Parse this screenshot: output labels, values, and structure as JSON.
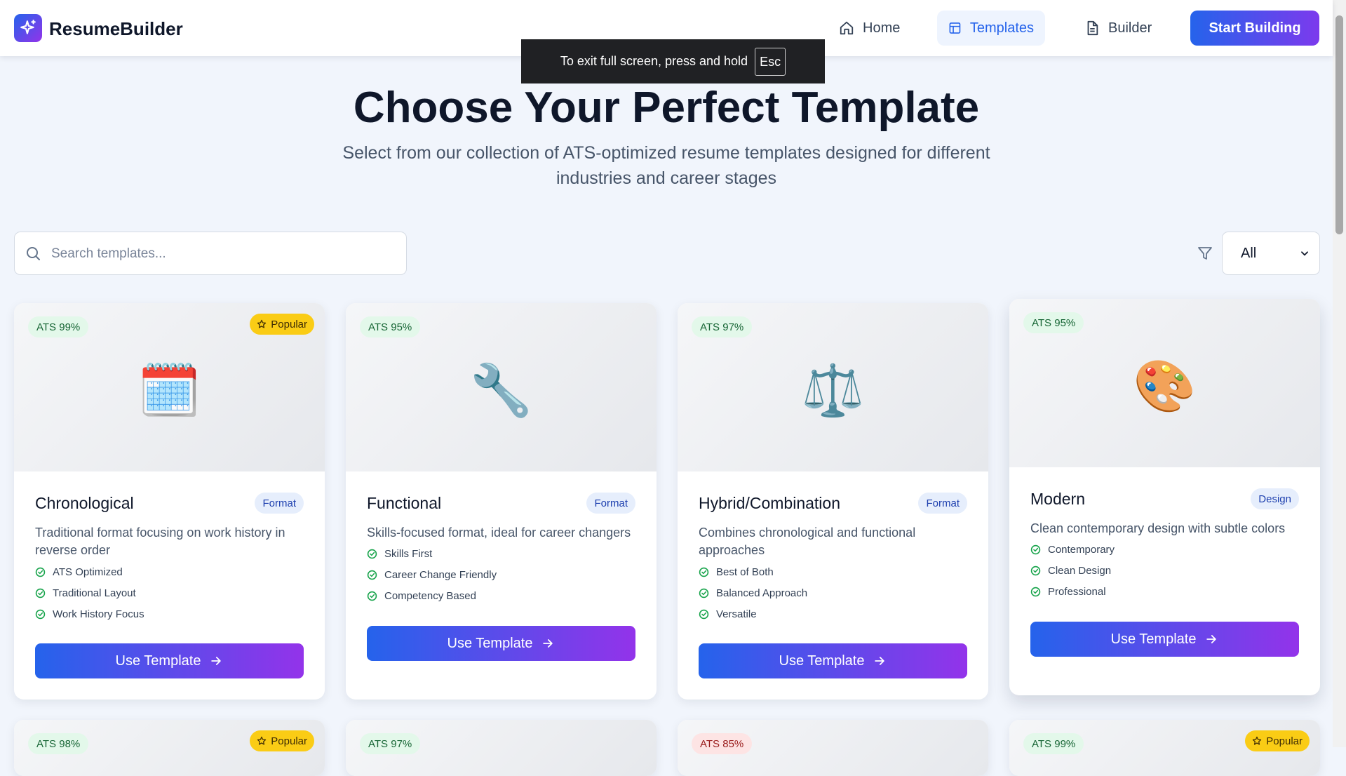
{
  "nav": {
    "brand": "ResumeBuilder",
    "links": [
      {
        "label": "Home",
        "icon": "home-icon"
      },
      {
        "label": "Templates",
        "icon": "layout-icon",
        "active": true
      },
      {
        "label": "Builder",
        "icon": "file-text-icon"
      }
    ],
    "cta": "Start Building"
  },
  "fullscreen_notice": {
    "text": "To exit full screen, press and hold",
    "key": "Esc"
  },
  "hero": {
    "title": "Choose Your Perfect Template",
    "subtitle": "Select from our collection of ATS-optimized resume templates designed for different industries and career stages"
  },
  "search": {
    "placeholder": "Search templates...",
    "value": ""
  },
  "filter": {
    "selected": "All"
  },
  "colors": {
    "accent": "#2563eb",
    "accent_end": "#9333ea",
    "ats_bg": "#e3f8ea",
    "popular": "#facc15"
  },
  "cards": [
    {
      "ats": "ATS 99%",
      "popular": "Popular",
      "emoji": "🗓️",
      "title": "Chronological",
      "tag": "Format",
      "desc": "Traditional format focusing on work history in reverse order",
      "features": [
        "ATS Optimized",
        "Traditional Layout",
        "Work History Focus"
      ],
      "button": "Use Template"
    },
    {
      "ats": "ATS 95%",
      "emoji": "🔧",
      "title": "Functional",
      "tag": "Format",
      "desc": "Skills-focused format, ideal for career changers",
      "features": [
        "Skills First",
        "Career Change Friendly",
        "Competency Based"
      ],
      "button": "Use Template"
    },
    {
      "ats": "ATS 97%",
      "emoji": "⚖️",
      "title": "Hybrid/Combination",
      "tag": "Format",
      "desc": "Combines chronological and functional approaches",
      "features": [
        "Best of Both",
        "Balanced Approach",
        "Versatile"
      ],
      "button": "Use Template"
    },
    {
      "ats": "ATS 95%",
      "emoji": "🎨",
      "title": "Modern",
      "tag": "Design",
      "desc": "Clean contemporary design with subtle colors",
      "features": [
        "Contemporary",
        "Clean Design",
        "Professional"
      ],
      "button": "Use Template"
    }
  ],
  "next_row": [
    {
      "ats": "ATS 98%",
      "popular": "Popular"
    },
    {
      "ats": "ATS 97%"
    },
    {
      "ats": "ATS 85%"
    },
    {
      "ats": "ATS 99%",
      "popular": "Popular"
    }
  ]
}
